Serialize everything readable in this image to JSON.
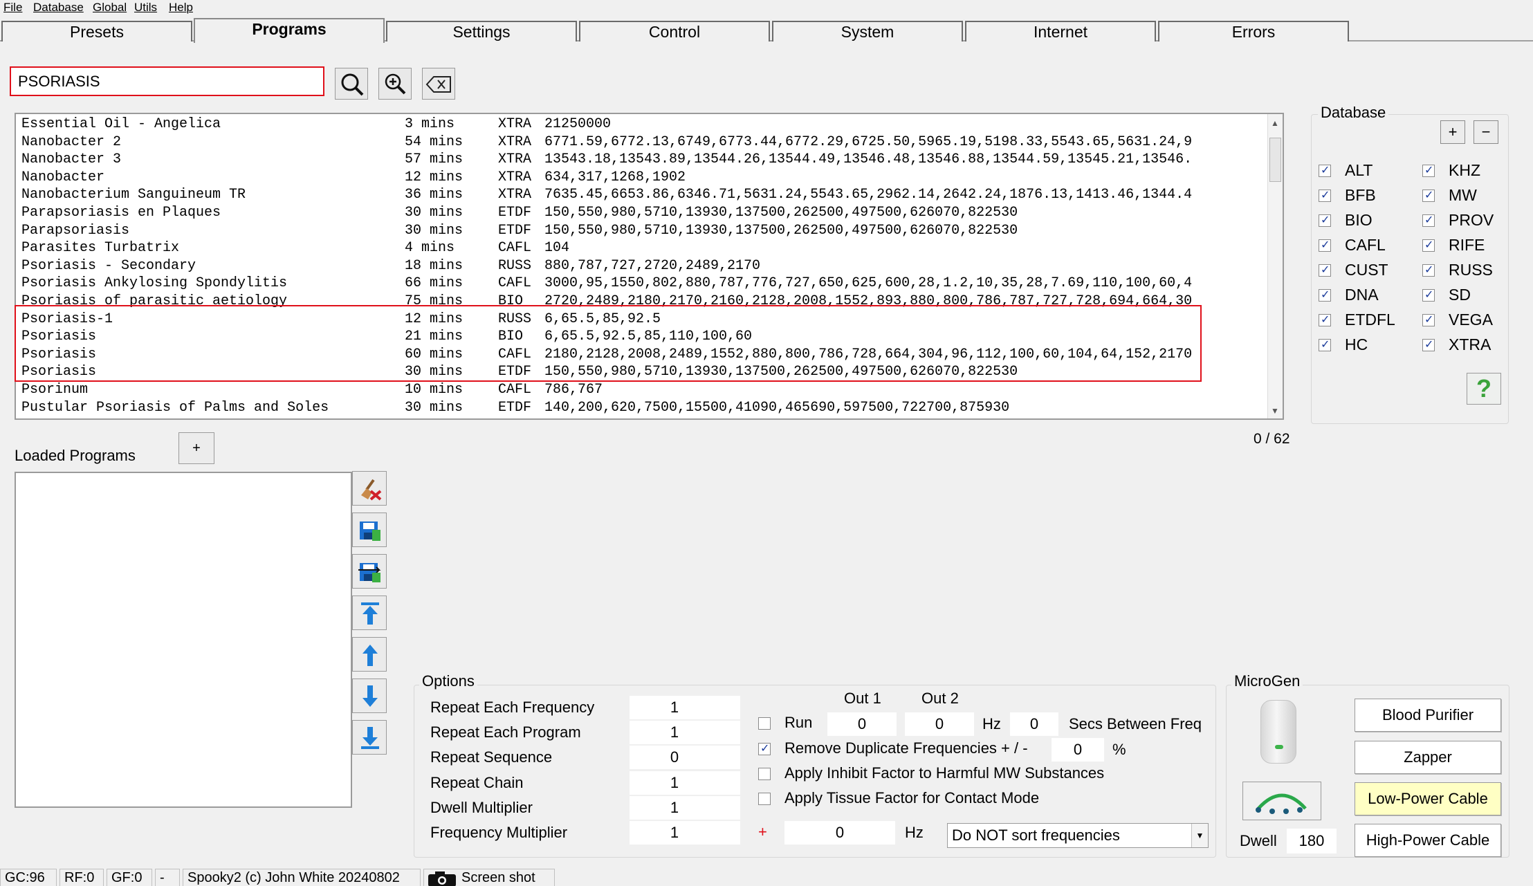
{
  "menu": {
    "file": "File",
    "database": "Database",
    "global": "Global",
    "utils": "Utils",
    "help": "Help"
  },
  "tabs": [
    "Presets",
    "Programs",
    "Settings",
    "Control",
    "System",
    "Internet",
    "Errors"
  ],
  "active_tab": "Programs",
  "search": {
    "value": "PSORIASIS"
  },
  "programs": [
    {
      "name": "Essential Oil - Angelica",
      "duration": "3 mins",
      "db": "XTRA",
      "freqs": "21250000"
    },
    {
      "name": "Nanobacter 2",
      "duration": "54 mins",
      "db": "XTRA",
      "freqs": "6771.59,6772.13,6749,6773.44,6772.29,6725.50,5965.19,5198.33,5543.65,5631.24,9"
    },
    {
      "name": "Nanobacter 3",
      "duration": "57 mins",
      "db": "XTRA",
      "freqs": "13543.18,13543.89,13544.26,13544.49,13546.48,13546.88,13544.59,13545.21,13546."
    },
    {
      "name": "Nanobacter",
      "duration": "12 mins",
      "db": "XTRA",
      "freqs": "634,317,1268,1902"
    },
    {
      "name": "Nanobacterium Sanguineum TR",
      "duration": "36 mins",
      "db": "XTRA",
      "freqs": "7635.45,6653.86,6346.71,5631.24,5543.65,2962.14,2642.24,1876.13,1413.46,1344.4"
    },
    {
      "name": "Parapsoriasis en Plaques",
      "duration": "30 mins",
      "db": "ETDF",
      "freqs": "150,550,980,5710,13930,137500,262500,497500,626070,822530"
    },
    {
      "name": "Parapsoriasis",
      "duration": "30 mins",
      "db": "ETDF",
      "freqs": "150,550,980,5710,13930,137500,262500,497500,626070,822530"
    },
    {
      "name": "Parasites Turbatrix",
      "duration": "4 mins",
      "db": "CAFL",
      "freqs": "104"
    },
    {
      "name": "Psoriasis - Secondary",
      "duration": "18 mins",
      "db": "RUSS",
      "freqs": "880,787,727,2720,2489,2170"
    },
    {
      "name": "Psoriasis Ankylosing Spondylitis",
      "duration": "66 mins",
      "db": "CAFL",
      "freqs": "3000,95,1550,802,880,787,776,727,650,625,600,28,1.2,10,35,28,7.69,110,100,60,4"
    },
    {
      "name": "Psoriasis of parasitic aetiology",
      "duration": "75 mins",
      "db": "BIO",
      "freqs": "2720,2489,2180,2170,2160,2128,2008,1552,893,880,800,786,787,727,728,694,664,30"
    },
    {
      "name": "Psoriasis-1",
      "duration": "12 mins",
      "db": "RUSS",
      "freqs": "6,65.5,85,92.5"
    },
    {
      "name": "Psoriasis",
      "duration": "21 mins",
      "db": "BIO",
      "freqs": "6,65.5,92.5,85,110,100,60"
    },
    {
      "name": "Psoriasis",
      "duration": "60 mins",
      "db": "CAFL",
      "freqs": "2180,2128,2008,2489,1552,880,800,786,728,664,304,96,112,100,60,104,64,152,2170"
    },
    {
      "name": "Psoriasis",
      "duration": "30 mins",
      "db": "ETDF",
      "freqs": "150,550,980,5710,13930,137500,262500,497500,626070,822530"
    },
    {
      "name": "Psorinum",
      "duration": "10 mins",
      "db": "CAFL",
      "freqs": "786,767"
    },
    {
      "name": "Pustular Psoriasis of Palms and Soles",
      "duration": "30 mins",
      "db": "ETDF",
      "freqs": "140,200,620,7500,15500,41090,465690,597500,722700,875930"
    }
  ],
  "database": {
    "title": "Database",
    "add_label": "+",
    "remove_label": "−",
    "left": [
      "ALT",
      "BFB",
      "BIO",
      "CAFL",
      "CUST",
      "DNA",
      "ETDFL",
      "HC"
    ],
    "right": [
      "KHZ",
      "MW",
      "PROV",
      "RIFE",
      "RUSS",
      "SD",
      "VEGA",
      "XTRA"
    ],
    "help_label": "?"
  },
  "counter": "0 / 62",
  "loaded": {
    "label": "Loaded Programs",
    "add_label": "+"
  },
  "side_buttons": [
    "clear-icon",
    "save-icon",
    "load-icon",
    "move-top-icon",
    "move-up-icon",
    "move-down-icon",
    "move-bottom-icon"
  ],
  "options": {
    "title": "Options",
    "rows": [
      {
        "label": "Repeat Each Frequency",
        "value": "1"
      },
      {
        "label": "Repeat Each Program",
        "value": "1"
      },
      {
        "label": "Repeat Sequence",
        "value": "0"
      },
      {
        "label": "Repeat Chain",
        "value": "1"
      },
      {
        "label": "Dwell Multiplier",
        "value": "1"
      },
      {
        "label": "Frequency Multiplier",
        "value": "1"
      }
    ],
    "out1_label": "Out 1",
    "out2_label": "Out 2",
    "run_label": "Run",
    "run_out1": "0",
    "run_out2": "0",
    "hz_label": "Hz",
    "secs_value": "0",
    "secs_label": "Secs Between Freq",
    "remove_dup_label": "Remove Duplicate Frequencies + / -",
    "remove_dup_value": "0",
    "percent_label": "%",
    "inhibit_label": "Apply Inhibit Factor to Harmful MW Substances",
    "tissue_label": "Apply Tissue Factor for Contact Mode",
    "offset_sign": "+",
    "offset_value": "0",
    "offset_hz": "Hz",
    "sort_value": "Do NOT sort frequencies"
  },
  "microgen": {
    "title": "MicroGen",
    "dwell_label": "Dwell",
    "dwell_value": "180",
    "buttons": [
      "Blood Purifier",
      "Zapper",
      "Low-Power Cable",
      "High-Power Cable"
    ],
    "active_button": "Low-Power Cable"
  },
  "status": {
    "gc": "GC:96",
    "rf": "RF:0",
    "gf": "GF:0",
    "dash": "-",
    "version": "Spooky2 (c) John White 20240802",
    "screenshot": "Screen shot"
  },
  "colors": {
    "highlight": "#e0101a",
    "active_button": "#ffffc4",
    "arrow_blue": "#1e7fd8"
  }
}
